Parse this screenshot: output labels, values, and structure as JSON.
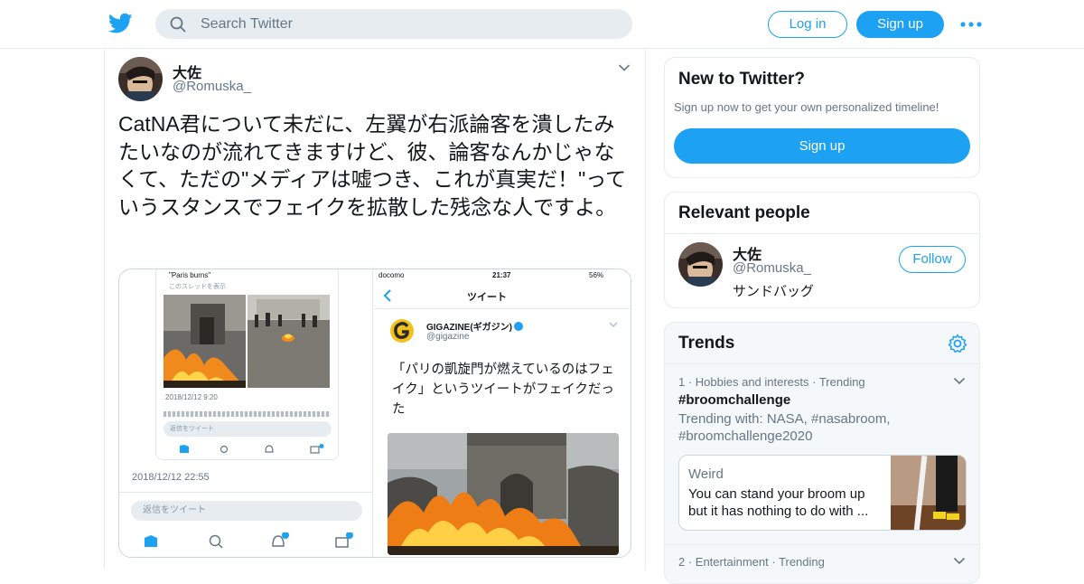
{
  "header": {
    "logo_icon": "twitter-bird-icon",
    "search_placeholder": "Search Twitter",
    "login_label": "Log in",
    "signup_label": "Sign up",
    "more_icon": "more-dots-icon",
    "brand_color": "#1da1f2"
  },
  "tweet": {
    "author_name": "大佐",
    "author_handle": "@Romuska_",
    "text": "CatNA君について未だに、左翼が右派論客を潰したみたいなのが流れてきますけど、彼、論客なんかじゃなくて、ただの\"メディアは嘘つき、これが真実だ！\"っていうスタンスでフェイクを拡散した残念な人ですよ。",
    "media": {
      "left": {
        "quoted_text": "\"Paris burns\"",
        "thread_link": "このスレッドを表示",
        "inner_date": "2018/12/12 9:20",
        "inner_reply_placeholder": "返信をツイート",
        "date": "2018/12/12 22:55",
        "reply_placeholder": "返信をツイート"
      },
      "right": {
        "carrier": "docomo",
        "time": "21:37",
        "battery": "56%",
        "nav_title": "ツイート",
        "account_name": "GIGAZINE(ギガジン)",
        "account_handle": "@gigazine",
        "text": "「パリの凱旋門が燃えているのはフェイク」というツイートがフェイクだった"
      }
    }
  },
  "sidebar": {
    "new_to_twitter": {
      "title": "New to Twitter?",
      "subtitle": "Sign up now to get your own personalized timeline!",
      "signup_label": "Sign up"
    },
    "relevant_people": {
      "title": "Relevant people",
      "name": "大佐",
      "handle": "@Romuska_",
      "bio": "サンドバッグ",
      "follow_label": "Follow"
    },
    "trends": {
      "title": "Trends",
      "items": [
        {
          "meta": "1 · Hobbies and interests · Trending",
          "tag": "#broomchallenge",
          "trending_with": "Trending with: NASA, #nasabroom, #broomchallenge2020",
          "card_category": "Weird",
          "card_text": "You can stand your broom up but it has nothing to do with ..."
        },
        {
          "meta": "2 · Entertainment · Trending"
        }
      ]
    }
  }
}
